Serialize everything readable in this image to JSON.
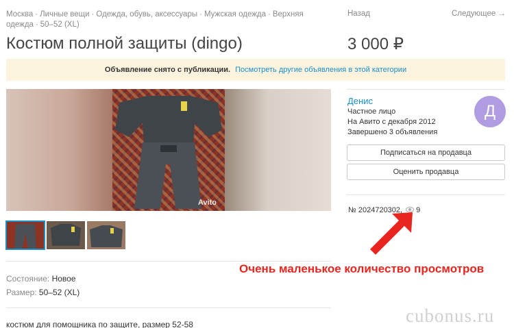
{
  "breadcrumbs": [
    "Москва",
    "Личные вещи",
    "Одежда, обувь, аксессуары",
    "Мужская одежда",
    "Верхняя одежда",
    "50–52 (XL)"
  ],
  "nav": {
    "back": "Назад",
    "next": "Следующее →"
  },
  "listing": {
    "title": "Костюм полной защиты (dingo)",
    "price": "3 000 ₽",
    "notice_bold": "Объявление снято с публикации.",
    "notice_link": "Посмотреть другие объявления в этой категории",
    "photo_watermark": "Avito",
    "condition_label": "Состояние:",
    "condition_value": "Новое",
    "size_label": "Размер:",
    "size_value": "50–52 (XL)",
    "description": "костюм для помощника по защите, размер 52-58",
    "number": "№ 2024720302,",
    "views": "9"
  },
  "seller": {
    "name": "Денис",
    "type": "Частное лицо",
    "since": "На Авито с декабря 2012",
    "completed": "Завершено 3 объявления",
    "avatar_letter": "Д",
    "subscribe_label": "Подписаться на продавца",
    "rate_label": "Оценить продавца"
  },
  "annotation": {
    "callout": "Очень маленькое количество просмотров",
    "site_watermark": "cubonus.ru"
  },
  "colors": {
    "link": "#1a8fc9",
    "callout": "#e8261f",
    "notice_bg": "#fbf3dd",
    "avatar": "#b09ce0"
  }
}
